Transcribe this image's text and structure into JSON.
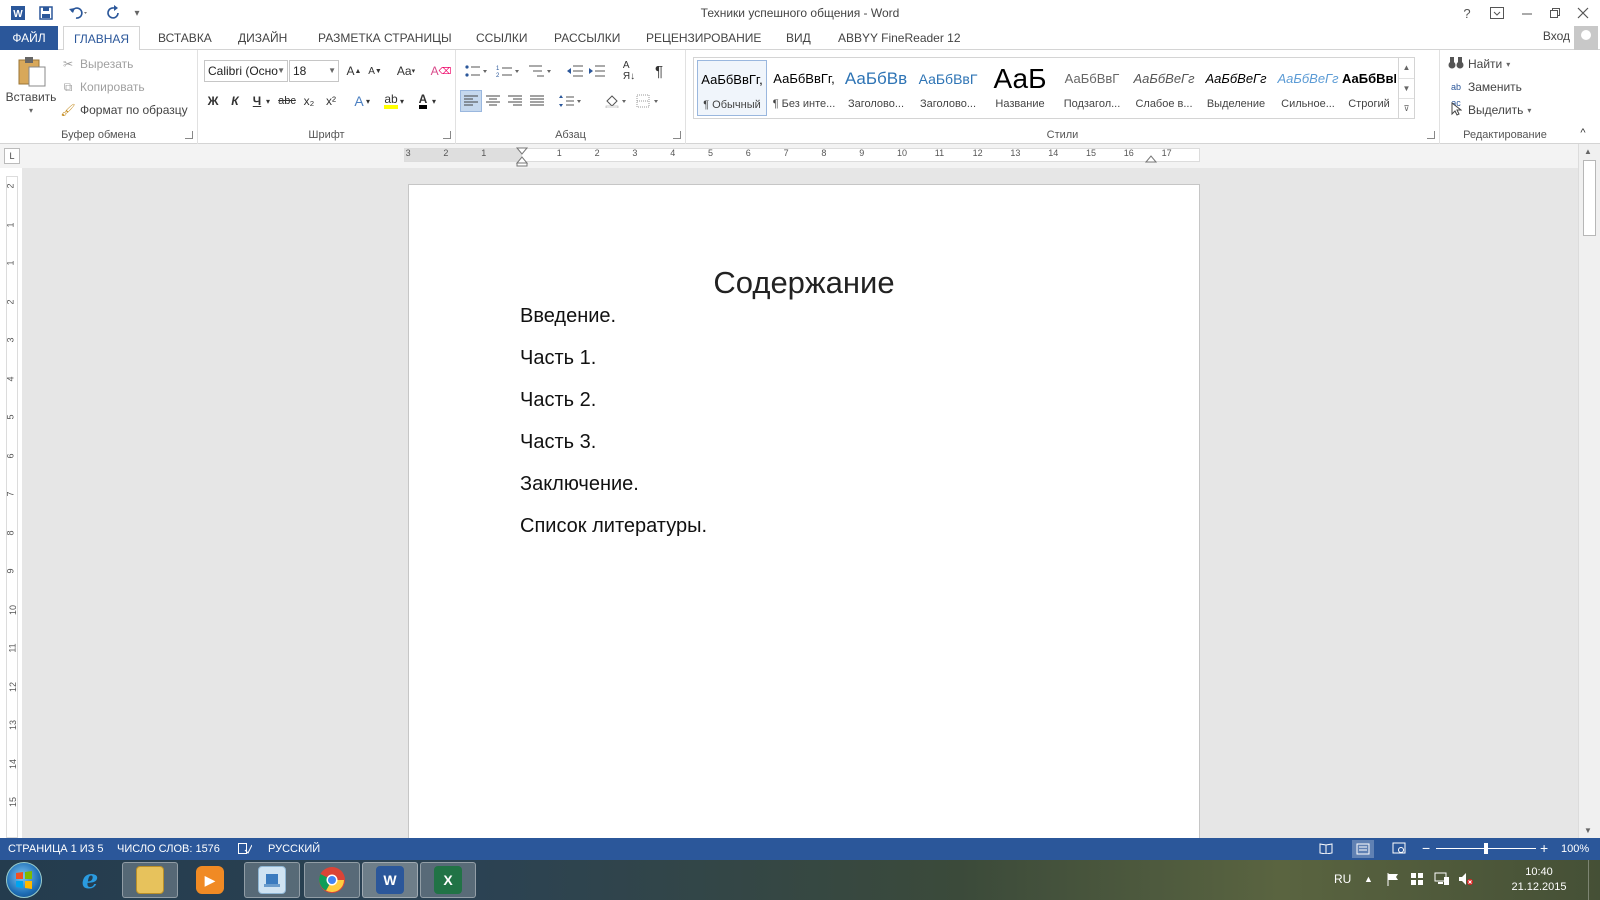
{
  "window": {
    "title": "Техники успешного общения - Word",
    "help": "?",
    "signin": "Вход"
  },
  "qat": {
    "word_icon": "word-icon",
    "save_icon": "save-icon",
    "undo_icon": "undo-icon",
    "redo_icon": "redo-icon",
    "customize": "₹"
  },
  "tabs": [
    {
      "label": "ФАЙЛ"
    },
    {
      "label": "ГЛАВНАЯ"
    },
    {
      "label": "ВСТАВКА"
    },
    {
      "label": "ДИЗАЙН"
    },
    {
      "label": "РАЗМЕТКА СТРАНИЦЫ"
    },
    {
      "label": "ССЫЛКИ"
    },
    {
      "label": "РАССЫЛКИ"
    },
    {
      "label": "РЕЦЕНЗИРОВАНИЕ"
    },
    {
      "label": "ВИД"
    },
    {
      "label": "ABBYY FineReader 12"
    }
  ],
  "clipboard": {
    "paste": "Вставить",
    "cut": "Вырезать",
    "copy": "Копировать",
    "format_painter": "Формат по образцу",
    "group": "Буфер обмена"
  },
  "font": {
    "name": "Calibri (Осно",
    "size": "18",
    "bold": "Ж",
    "italic": "К",
    "underline": "Ч",
    "strike": "abc",
    "sub": "x₂",
    "sup": "x²",
    "group": "Шрифт"
  },
  "paragraph": {
    "group": "Абзац"
  },
  "styles": {
    "group": "Стили",
    "items": [
      {
        "preview": "АаБбВвГг,",
        "name": "¶ Обычный"
      },
      {
        "preview": "АаБбВвГг,",
        "name": "¶ Без инте..."
      },
      {
        "preview": "АаБбВв",
        "name": "Заголово..."
      },
      {
        "preview": "АаБбВвГ",
        "name": "Заголово..."
      },
      {
        "preview": "АаБ",
        "name": "Название"
      },
      {
        "preview": "АаБбВвГ",
        "name": "Подзагол..."
      },
      {
        "preview": "АаБбВеГг",
        "name": "Слабое в..."
      },
      {
        "preview": "АаБбВеГг",
        "name": "Выделение"
      },
      {
        "preview": "АаБбВеГг",
        "name": "Сильное..."
      },
      {
        "preview": "АаБбВвГг,",
        "name": "Строгий"
      }
    ]
  },
  "editing": {
    "find": "Найти",
    "replace": "Заменить",
    "select": "Выделить",
    "group": "Редактирование"
  },
  "ruler": {
    "h_numbers": [
      "3",
      "2",
      "1",
      "1",
      "2",
      "3",
      "4",
      "5",
      "6",
      "7",
      "8",
      "9",
      "10",
      "11",
      "12",
      "13",
      "14",
      "15",
      "16",
      "17"
    ],
    "v_numbers": [
      "2",
      "1",
      "1",
      "2",
      "3",
      "4",
      "5",
      "6",
      "7",
      "8",
      "9",
      "10",
      "11",
      "12",
      "13",
      "14",
      "15"
    ],
    "tab_selector": "L"
  },
  "document": {
    "heading": "Содержание",
    "toc": [
      "Введение.",
      "Часть 1.",
      "Часть 2.",
      "Часть 3.",
      "Заключение.",
      "Список литературы."
    ]
  },
  "status": {
    "page": "СТРАНИЦА 1 ИЗ 5",
    "words": "ЧИСЛО СЛОВ: 1576",
    "language": "РУССКИЙ",
    "zoom": "100%",
    "zoom_minus": "−",
    "zoom_plus": "+"
  },
  "taskbar": {
    "lang": "RU",
    "time": "10:40",
    "date": "21.12.2015"
  },
  "colors": {
    "accent": "#2b579a",
    "ribbon_bg": "#ffffff",
    "canvas": "#e6e6e6"
  }
}
